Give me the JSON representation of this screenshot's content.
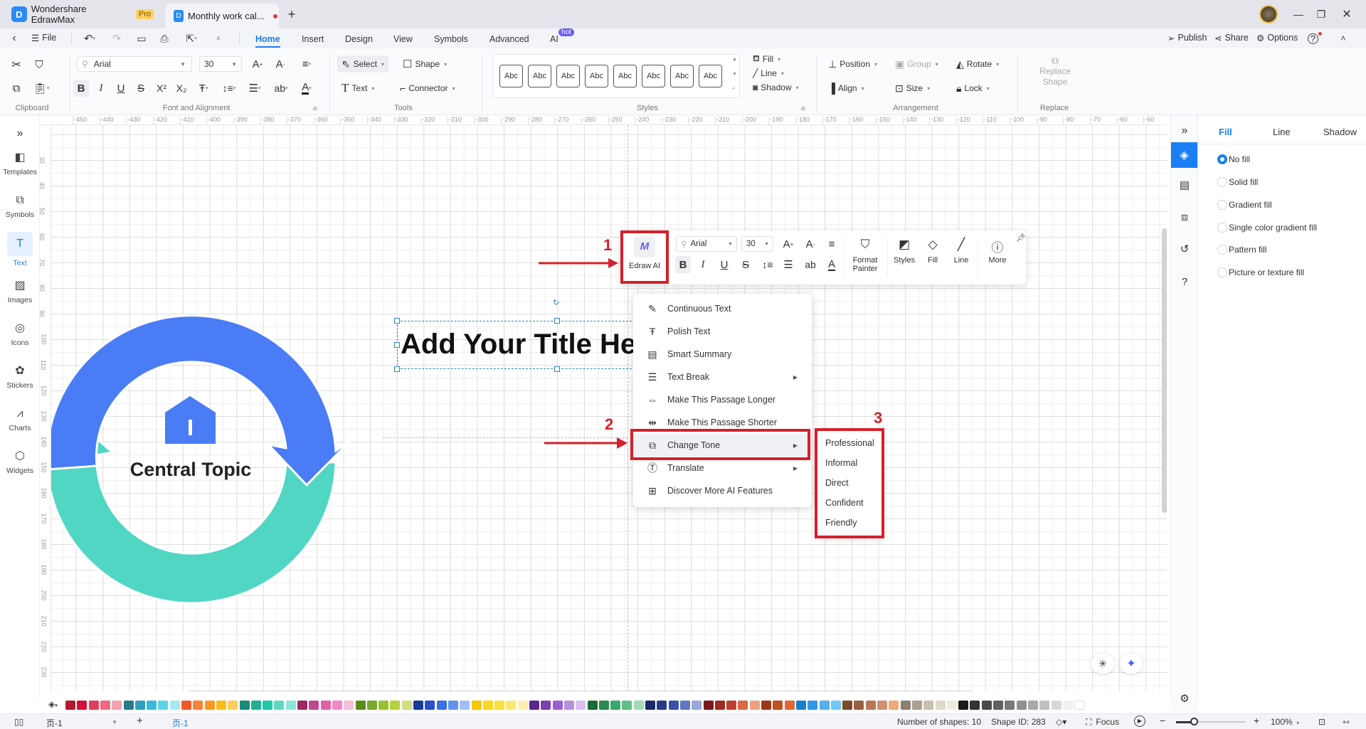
{
  "app": {
    "name": "Wondershare EdrawMax",
    "badge": "Pro"
  },
  "document_tab": {
    "title": "Monthly work cal...",
    "unsaved": true
  },
  "menu": {
    "file": "File",
    "tabs": [
      "Home",
      "Insert",
      "Design",
      "View",
      "Symbols",
      "Advanced",
      "AI"
    ],
    "active_tab": "Home",
    "ai_badge": "hot",
    "publish": "Publish",
    "share": "Share",
    "options": "Options"
  },
  "ribbon": {
    "clipboard_label": "Clipboard",
    "font": "Arial",
    "font_size": "30",
    "font_group_label": "Font and Alignment",
    "tools": {
      "select": "Select",
      "shape": "Shape",
      "text": "Text",
      "connector": "Connector",
      "label": "Tools"
    },
    "styles": {
      "swatches": [
        "Abc",
        "Abc",
        "Abc",
        "Abc",
        "Abc",
        "Abc",
        "Abc",
        "Abc"
      ],
      "fill": "Fill",
      "line": "Line",
      "shadow": "Shadow",
      "label": "Styles"
    },
    "arrangement": {
      "position": "Position",
      "group": "Group",
      "rotate": "Rotate",
      "align": "Align",
      "size": "Size",
      "lock": "Lock",
      "label": "Arrangement"
    },
    "replace": {
      "button_line1": "Replace",
      "button_line2": "Shape",
      "label": "Replace"
    }
  },
  "sidebar": {
    "items": [
      "Templates",
      "Symbols",
      "Text",
      "Images",
      "Icons",
      "Stickers",
      "Charts",
      "Widgets"
    ],
    "active": "Text"
  },
  "rulers": {
    "top": [
      "-450",
      "-440",
      "-430",
      "-420",
      "-410",
      "-400",
      "-390",
      "-380",
      "-370",
      "-360",
      "-350",
      "-340",
      "-330",
      "-320",
      "-310",
      "-300",
      "-290",
      "-280",
      "-270",
      "-260",
      "-250",
      "-240",
      "-230",
      "-220",
      "-210",
      "-200",
      "-190",
      "-180",
      "-170",
      "-160",
      "-150",
      "-140",
      "-130",
      "-120",
      "-110",
      "-100",
      "-90",
      "-80",
      "-70",
      "-60",
      "-50"
    ],
    "left": [
      "30",
      "40",
      "50",
      "60",
      "70",
      "80",
      "90",
      "100",
      "110",
      "120",
      "130",
      "140",
      "150",
      "160",
      "170",
      "180",
      "190",
      "200",
      "210",
      "220",
      "230"
    ]
  },
  "canvas": {
    "title_text": "Add Your Title He",
    "central_topic": "Central Topic",
    "colors": {
      "blue_arrow": "#4a7cf6",
      "green_arrow": "#52d6c4",
      "selection": "#2a8ab0"
    }
  },
  "floating_toolbar": {
    "edraw_ai": "Edraw AI",
    "font": "Arial",
    "font_size": "30",
    "format_painter_line1": "Format",
    "format_painter_line2": "Painter",
    "styles": "Styles",
    "fill": "Fill",
    "line": "Line",
    "more": "More"
  },
  "ai_menu": {
    "items": [
      {
        "label": "Continuous Text",
        "icon": "pen-lines-icon",
        "submenu": false
      },
      {
        "label": "Polish Text",
        "icon": "text-polish-icon",
        "submenu": false
      },
      {
        "label": "Smart Summary",
        "icon": "summary-icon",
        "submenu": false
      },
      {
        "label": "Text Break",
        "icon": "list-icon",
        "submenu": true
      },
      {
        "label": "Make This Passage Longer",
        "icon": "expand-icon",
        "submenu": false
      },
      {
        "label": "Make This Passage Shorter",
        "icon": "shrink-icon",
        "submenu": false
      },
      {
        "label": "Change Tone",
        "icon": "tone-icon",
        "submenu": true
      },
      {
        "label": "Translate",
        "icon": "translate-icon",
        "submenu": true
      },
      {
        "label": "Discover More AI Features",
        "icon": "plus-box-icon",
        "submenu": false
      }
    ],
    "highlighted": "Change Tone",
    "tone_submenu": [
      "Professional",
      "Informal",
      "Direct",
      "Confident",
      "Friendly"
    ]
  },
  "annotations": {
    "step1": "1",
    "step2": "2",
    "step3": "3",
    "color": "#d6202a"
  },
  "right_panel": {
    "tabs": [
      "Fill",
      "Line",
      "Shadow"
    ],
    "active_tab": "Fill",
    "options": [
      "No fill",
      "Solid fill",
      "Gradient fill",
      "Single color gradient fill",
      "Pattern fill",
      "Picture or texture fill"
    ],
    "selected": "No fill",
    "accent": "#1a7ef5"
  },
  "palette": [
    "#b01c2e",
    "#d0103a",
    "#e0405a",
    "#ef6a80",
    "#f5a0b0",
    "#2a7a8c",
    "#31a0b8",
    "#3cb8d8",
    "#5cd4e8",
    "#a8e8f5",
    "#f05a28",
    "#f7823a",
    "#f79a20",
    "#fbbc1a",
    "#fccc60",
    "#178a78",
    "#1fb090",
    "#20c8a8",
    "#60d8c0",
    "#88e8d8",
    "#9a2a60",
    "#c04890",
    "#e060a8",
    "#f088c8",
    "#f5c0d8",
    "#5a8a1a",
    "#78a830",
    "#98c030",
    "#b8d040",
    "#d0e080",
    "#1a3a9a",
    "#2a50c8",
    "#3a70e0",
    "#6090f0",
    "#a0c0f8",
    "#f5c800",
    "#f8d820",
    "#fae040",
    "#fbe878",
    "#fcf0b0",
    "#5a2a8a",
    "#7a40b0",
    "#9a60d0",
    "#b890e0",
    "#d8c0f0",
    "#1a6a3a",
    "#2a8a50",
    "#3aa868",
    "#60c088",
    "#a0dcb8",
    "#1a2a6a",
    "#2a3a8a",
    "#3a50a8",
    "#6078c0",
    "#98a8d8",
    "#7a1a1a",
    "#a02a20",
    "#c04030",
    "#d86848",
    "#f0a080",
    "#a03818",
    "#c05020",
    "#e06838",
    "#1a80d0",
    "#3098e8",
    "#50b0f0",
    "#70c8f8",
    "#7a4a2a",
    "#9a6040",
    "#b87858",
    "#d09070",
    "#f0a878",
    "#8a8070",
    "#aaa090",
    "#c8c0b0",
    "#ddd8c8",
    "#f0ecdc",
    "#1a1a1a",
    "#333333",
    "#4a4a4a",
    "#606060",
    "#787878",
    "#909090",
    "#a8a8a8",
    "#c0c0c0",
    "#d8d8d8",
    "#f0f0f0",
    "#ffffff"
  ],
  "status": {
    "page_selector": "页-1",
    "page_tab": "页-1",
    "shape_count": "Number of shapes: 10",
    "shape_id": "Shape ID: 283",
    "focus": "Focus",
    "zoom": "100%"
  }
}
